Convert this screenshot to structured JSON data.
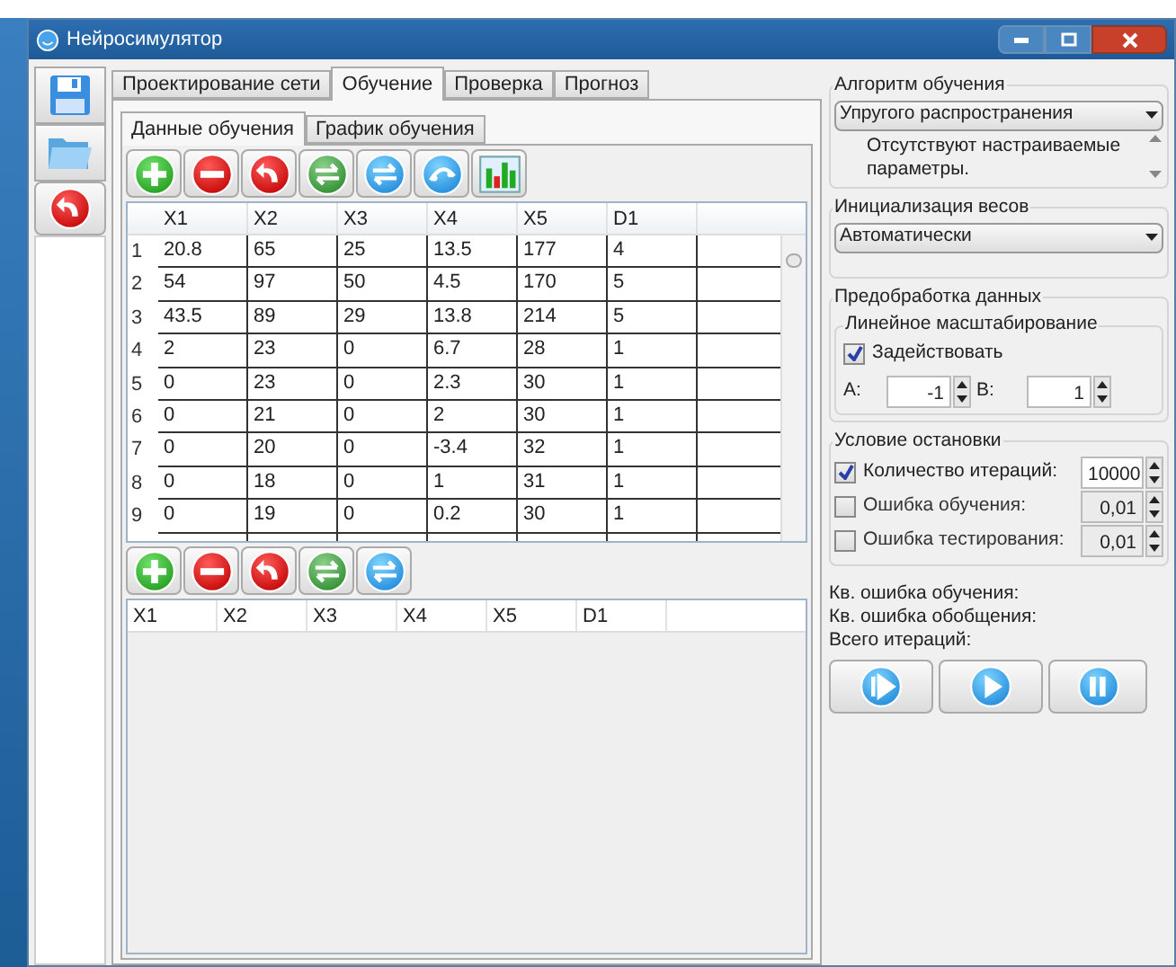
{
  "window": {
    "title": "Нейросимулятор"
  },
  "tabs": [
    {
      "label": "Проектирование сети",
      "selected": false
    },
    {
      "label": "Обучение",
      "selected": true
    },
    {
      "label": "Проверка",
      "selected": false
    },
    {
      "label": "Прогноз",
      "selected": false
    }
  ],
  "subtabs": [
    {
      "label": "Данные обучения",
      "selected": true
    },
    {
      "label": "График обучения",
      "selected": false
    }
  ],
  "training_table": {
    "columns": [
      "X1",
      "X2",
      "X3",
      "X4",
      "X5",
      "D1"
    ],
    "rows": [
      {
        "number": "1",
        "cells": [
          "20.8",
          "65",
          "25",
          "13.5",
          "177",
          "4"
        ]
      },
      {
        "number": "2",
        "cells": [
          "54",
          "97",
          "50",
          "4.5",
          "170",
          "5"
        ]
      },
      {
        "number": "3",
        "cells": [
          "43.5",
          "89",
          "29",
          "13.8",
          "214",
          "5"
        ]
      },
      {
        "number": "4",
        "cells": [
          "2",
          "23",
          "0",
          "6.7",
          "28",
          "1"
        ]
      },
      {
        "number": "5",
        "cells": [
          "0",
          "23",
          "0",
          "2.3",
          "30",
          "1"
        ]
      },
      {
        "number": "6",
        "cells": [
          "0",
          "21",
          "0",
          "2",
          "30",
          "1"
        ]
      },
      {
        "number": "7",
        "cells": [
          "0",
          "20",
          "0",
          "-3.4",
          "32",
          "1"
        ]
      },
      {
        "number": "8",
        "cells": [
          "0",
          "18",
          "0",
          "1",
          "31",
          "1"
        ]
      },
      {
        "number": "9",
        "cells": [
          "0",
          "19",
          "0",
          "0.2",
          "30",
          "1"
        ]
      }
    ]
  },
  "test_table": {
    "columns": [
      "X1",
      "X2",
      "X3",
      "X4",
      "X5",
      "D1"
    ]
  },
  "algorithm": {
    "title": "Алгоритм обучения",
    "value": "Упругого распространения",
    "note": "Отсутствуют настраиваемые параметры."
  },
  "weights": {
    "title": "Инициализация весов",
    "value": "Автоматически"
  },
  "preprocessing": {
    "title": "Предобработка данных",
    "subtitle": "Линейное масштабирование",
    "enable": {
      "label": "Задействовать",
      "checked": true
    },
    "a": {
      "label": "A:",
      "value": "-1"
    },
    "b": {
      "label": "B:",
      "value": "1"
    }
  },
  "stop": {
    "title": "Условие остановки",
    "items": [
      {
        "label": "Количество итераций:",
        "checked": true,
        "value": "10000"
      },
      {
        "label": "Ошибка обучения:",
        "checked": false,
        "value": "0,01"
      },
      {
        "label": "Ошибка тестирования:",
        "checked": false,
        "value": "0,01"
      }
    ]
  },
  "stats": [
    "Кв. ошибка обучения:",
    "Кв. ошибка обобщения:",
    "Всего итераций:"
  ]
}
